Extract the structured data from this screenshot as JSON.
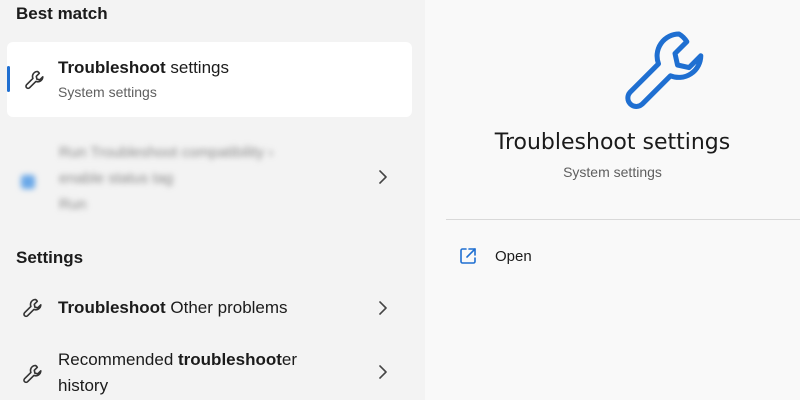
{
  "best_match": {
    "heading": "Best match",
    "item": {
      "title_bold": "Troubleshoot",
      "title_rest": " settings",
      "subtitle": "System settings",
      "icon": "wrench-icon"
    }
  },
  "blurred_result": {
    "line1": "Run Troubleshoot compatibility ›",
    "line2": "enable status tag",
    "line3": "Run"
  },
  "settings_section": {
    "heading": "Settings",
    "items": [
      {
        "pre": "",
        "bold": "Troubleshoot",
        "post": " Other problems",
        "icon": "wrench-icon"
      },
      {
        "pre": "Recommended ",
        "bold": "troubleshoot",
        "post": "er",
        "line2": "history",
        "icon": "wrench-icon"
      }
    ]
  },
  "detail": {
    "title": "Troubleshoot settings",
    "subtitle": "System settings",
    "icon": "wrench-icon",
    "accent_color": "#1f6fd1",
    "actions": [
      {
        "label": "Open",
        "icon": "open-external-icon"
      }
    ]
  }
}
